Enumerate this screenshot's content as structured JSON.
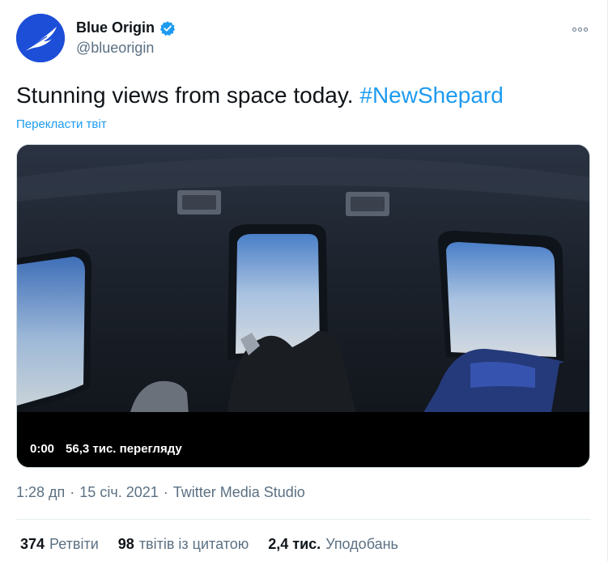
{
  "author": {
    "display_name": "Blue Origin",
    "handle": "@blueorigin",
    "verified": true,
    "avatar_icon": "feather-icon"
  },
  "tweet": {
    "text": "Stunning views from space today.",
    "hashtag": "#NewShepard",
    "translate_label": "Перекласти твіт"
  },
  "video": {
    "time": "0:00",
    "views": "56,3 тис. перегляду"
  },
  "meta": {
    "time": "1:28 дп",
    "separator": "·",
    "date": "15 січ. 2021",
    "source": "Twitter Media Studio"
  },
  "stats": {
    "retweets_count": "374",
    "retweets_label": "Ретвіти",
    "quotes_count": "98",
    "quotes_label": "твітів із цитатою",
    "likes_count": "2,4 тис.",
    "likes_label": "Уподобань"
  },
  "colors": {
    "accent": "#1d9bf0",
    "avatar_bg": "#1d4ed8",
    "secondary_text": "#5b7083"
  }
}
